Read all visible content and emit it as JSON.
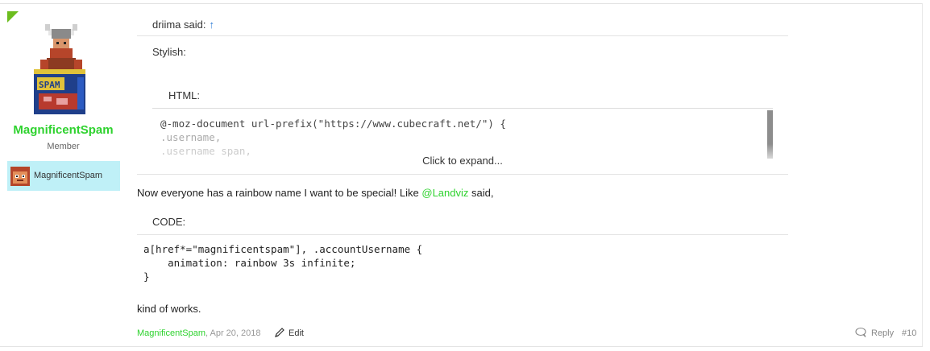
{
  "author": {
    "username": "MagnificentSpam",
    "title": "Member",
    "banner_name": "MagnificentSpam",
    "avatar_icon": "viking-on-spam-can-avatar",
    "banner_icon": "pixel-face-icon",
    "name_color": "#2ed22e"
  },
  "quote": {
    "author_said": "driima said:",
    "jump_arrow": "↑",
    "stylish": "Stylish:",
    "html_label": "HTML:",
    "code_lines": [
      "@-moz-document url-prefix(\"https://www.cubecraft.net/\") {",
      ".username,",
      ".username span,"
    ],
    "expand": "Click to expand..."
  },
  "body": {
    "line1_before": "Now everyone has a rainbow name I want to be special! Like ",
    "mention": "@Landviz",
    "line1_after": " said,",
    "code_label": "CODE:",
    "code_lines": [
      "a[href*=\"magnificentspam\"], .accountUsername {",
      "    animation: rainbow 3s infinite;",
      "}"
    ],
    "line2": "kind of works."
  },
  "footer": {
    "author": "MagnificentSpam",
    "date": ", Apr 20, 2018",
    "edit": "Edit",
    "reply": "Reply",
    "post_number": "#10"
  },
  "colors": {
    "accent_green": "#6cbd1e",
    "banner_bg": "#bff0f7",
    "link_blue": "#2b7bd6"
  }
}
